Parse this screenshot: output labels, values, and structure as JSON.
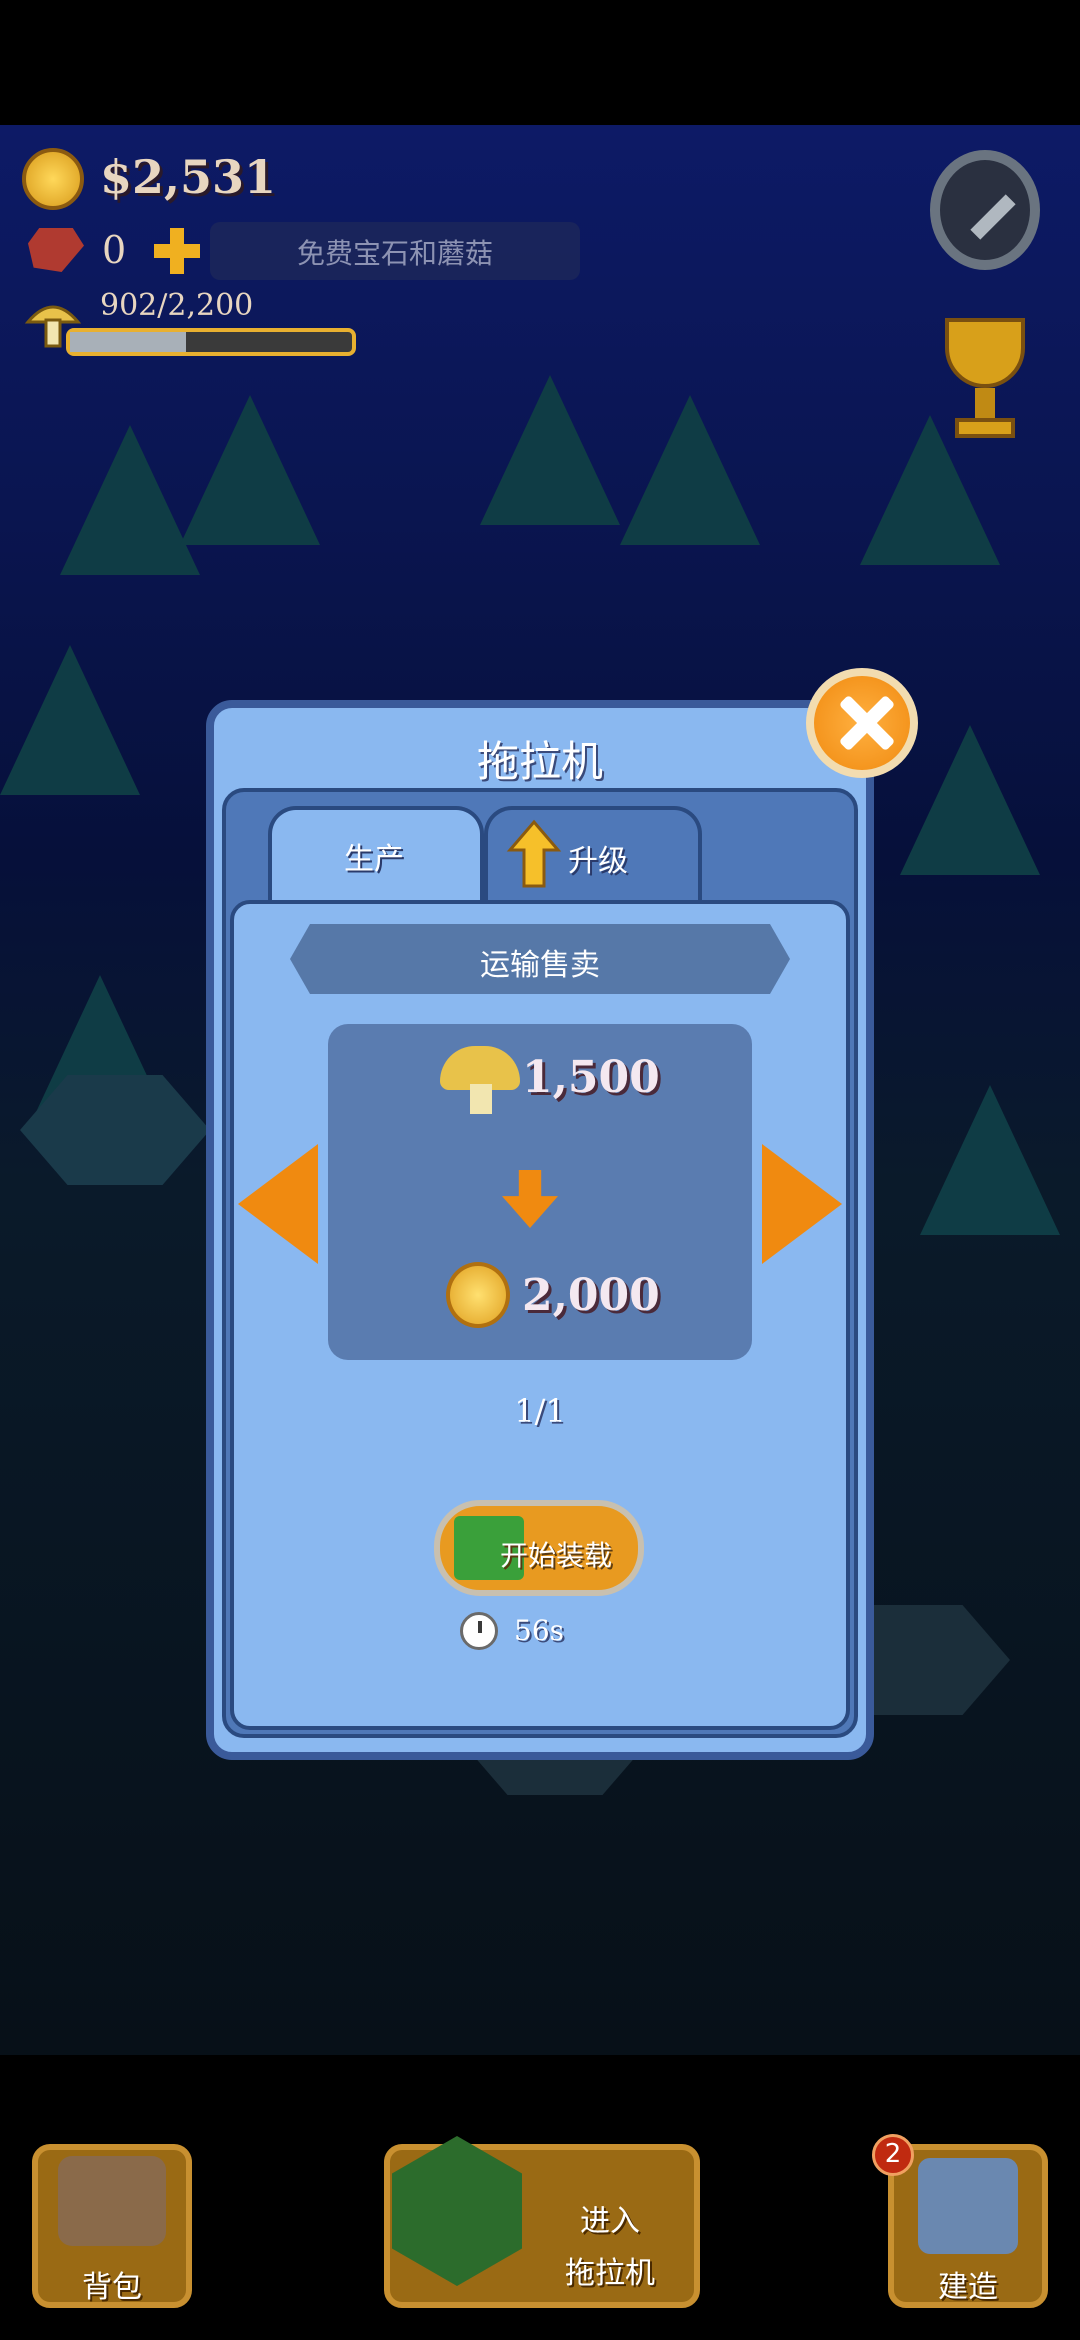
{
  "hud": {
    "money": "$2,531",
    "gems": "0",
    "free_offer": "免费宝石和蘑菇",
    "mushrooms": "902/2,200",
    "mushroom_progress": 0.41
  },
  "dialog": {
    "title": "拖拉机",
    "tabs": [
      {
        "label": "生产"
      },
      {
        "label": "升级"
      }
    ],
    "recipe_title": "运输售卖",
    "input_amount": "1,500",
    "output_amount": "2,000",
    "page_counter": "1/1",
    "start_button": "开始装载",
    "timer": "56s"
  },
  "bottom_bar": {
    "bag_label": "背包",
    "enter_line1": "进入",
    "enter_line2": "拖拉机",
    "build_label": "建造",
    "build_badge": "2"
  },
  "colors": {
    "dialog_bg": "#8ab8f0",
    "accent_orange": "#f08a10",
    "gold": "#e8b030"
  },
  "icons": [
    "coin-icon",
    "gem-icon",
    "plus-icon",
    "mushroom-icon",
    "wrench-icon",
    "trophy-icon",
    "close-icon",
    "upgrade-arrow-icon",
    "arrow-left-icon",
    "arrow-right-icon",
    "down-arrow-icon",
    "clock-icon",
    "tractor-icon",
    "bag-icon",
    "build-icon"
  ]
}
